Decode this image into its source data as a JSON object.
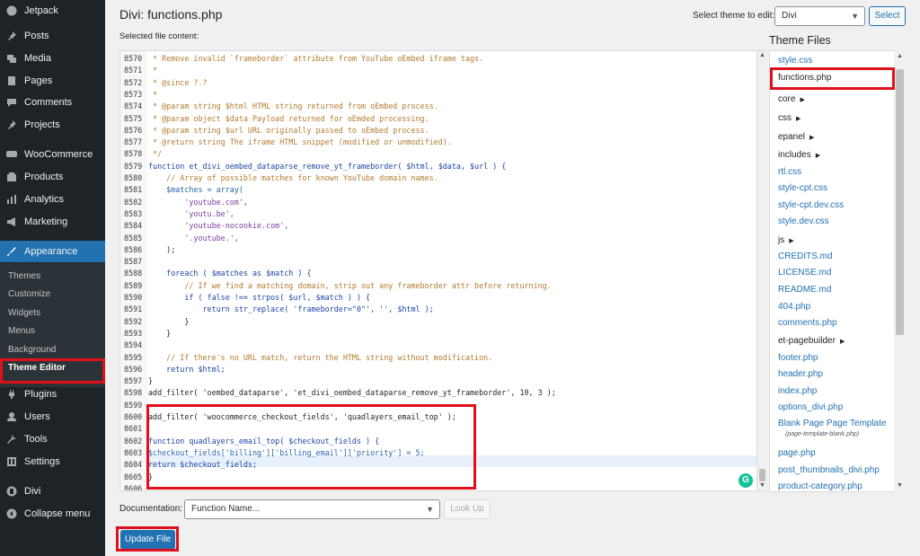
{
  "sidebar": {
    "menu": [
      {
        "label": "Jetpack",
        "icon": "jetpack-icon"
      },
      {
        "label": "Posts",
        "icon": "pin-icon"
      },
      {
        "label": "Media",
        "icon": "media-icon"
      },
      {
        "label": "Pages",
        "icon": "page-icon"
      },
      {
        "label": "Comments",
        "icon": "comment-icon"
      },
      {
        "label": "Projects",
        "icon": "pin-icon"
      },
      {
        "label": "WooCommerce",
        "icon": "woo-icon"
      },
      {
        "label": "Products",
        "icon": "product-icon"
      },
      {
        "label": "Analytics",
        "icon": "analytics-icon"
      },
      {
        "label": "Marketing",
        "icon": "megaphone-icon"
      },
      {
        "label": "Appearance",
        "icon": "brush-icon"
      },
      {
        "label": "Plugins",
        "icon": "plug-icon"
      },
      {
        "label": "Users",
        "icon": "user-icon"
      },
      {
        "label": "Tools",
        "icon": "wrench-icon"
      },
      {
        "label": "Settings",
        "icon": "settings-icon"
      },
      {
        "label": "Divi",
        "icon": "divi-icon"
      },
      {
        "label": "Collapse menu",
        "icon": "collapse-icon"
      }
    ],
    "submenu": [
      "Themes",
      "Customize",
      "Widgets",
      "Menus",
      "Background",
      "Theme Editor"
    ],
    "active_menu": "Appearance",
    "current_submenu": "Theme Editor",
    "accent_color": "#2271b1"
  },
  "header": {
    "title": "Divi: functions.php",
    "selected_file_label": "Selected file content:",
    "theme_select_label": "Select theme to edit:",
    "theme_select_value": "Divi",
    "select_button": "Select"
  },
  "editor": {
    "lines": [
      {
        "n": "8570",
        "t": " * Remove invalid `frameborder` attribute from YouTube oEmbed iframe tags."
      },
      {
        "n": "8571",
        "t": " *"
      },
      {
        "n": "8572",
        "t": " * @since ?.?"
      },
      {
        "n": "8573",
        "t": " *"
      },
      {
        "n": "8574",
        "t": " * @param string $html HTML string returned from oEmbed process."
      },
      {
        "n": "8575",
        "t": " * @param object $data Payload returned for oEmded processing."
      },
      {
        "n": "8576",
        "t": " * @param string $url URL originally passed to oEmbed process."
      },
      {
        "n": "8577",
        "t": " * @return string The iframe HTML snippet (modified or unmodified)."
      },
      {
        "n": "8578",
        "t": " */"
      },
      {
        "n": "8579",
        "t": "function et_divi_oembed_dataparse_remove_yt_frameborder( $html, $data, $url ) {"
      },
      {
        "n": "8580",
        "t": "    // Array of possible matches for known YouTube domain names."
      },
      {
        "n": "8581",
        "t": "    $matches = array("
      },
      {
        "n": "8582",
        "t": "        'youtube.com',"
      },
      {
        "n": "8583",
        "t": "        'youtu.be',"
      },
      {
        "n": "8584",
        "t": "        'youtube-nocookie.com',"
      },
      {
        "n": "8585",
        "t": "        '.youtube.',"
      },
      {
        "n": "8586",
        "t": "    );"
      },
      {
        "n": "8587",
        "t": ""
      },
      {
        "n": "8588",
        "t": "    foreach ( $matches as $match ) {"
      },
      {
        "n": "8589",
        "t": "        // If we find a matching domain, strip out any frameborder attr before returning."
      },
      {
        "n": "8590",
        "t": "        if ( false !== strpos( $url, $match ) ) {"
      },
      {
        "n": "8591",
        "t": "            return str_replace( 'frameborder=\"0\"', '', $html );"
      },
      {
        "n": "8592",
        "t": "        }"
      },
      {
        "n": "8593",
        "t": "    }"
      },
      {
        "n": "8594",
        "t": ""
      },
      {
        "n": "8595",
        "t": "    // If there's no URL match, return the HTML string without modification."
      },
      {
        "n": "8596",
        "t": "    return $html;"
      },
      {
        "n": "8597",
        "t": "}"
      },
      {
        "n": "8598",
        "t": "add_filter( 'oembed_dataparse', 'et_divi_oembed_dataparse_remove_yt_frameborder', 10, 3 );"
      },
      {
        "n": "8599",
        "t": ""
      },
      {
        "n": "8600",
        "t": "add_filter( 'woocommerce_checkout_fields', 'quadlayers_email_top' );"
      },
      {
        "n": "8601",
        "t": ""
      },
      {
        "n": "8602",
        "t": "function quadlayers_email_top( $checkout_fields ) {"
      },
      {
        "n": "8603",
        "t": "$checkout_fields['billing']['billing_email']['priority'] = 5;"
      },
      {
        "n": "8604",
        "t": "return $checkout_fields;"
      },
      {
        "n": "8605",
        "t": "}"
      },
      {
        "n": "8606",
        "t": ""
      }
    ],
    "highlight_color": "#e0101b",
    "grammarly_label": "G"
  },
  "theme_files": {
    "title": "Theme Files",
    "items": [
      {
        "label": "style.css",
        "dir": false
      },
      {
        "label": "functions.php",
        "dir": false,
        "current": true
      },
      {
        "label": "core",
        "dir": true
      },
      {
        "label": "css",
        "dir": true
      },
      {
        "label": "epanel",
        "dir": true
      },
      {
        "label": "includes",
        "dir": true
      },
      {
        "label": "rtl.css",
        "dir": false
      },
      {
        "label": "style-cpt.css",
        "dir": false
      },
      {
        "label": "style-cpt.dev.css",
        "dir": false
      },
      {
        "label": "style.dev.css",
        "dir": false
      },
      {
        "label": "js",
        "dir": true
      },
      {
        "label": "CREDITS.md",
        "dir": false
      },
      {
        "label": "LICENSE.md",
        "dir": false
      },
      {
        "label": "README.md",
        "dir": false
      },
      {
        "label": "404.php",
        "dir": false
      },
      {
        "label": "comments.php",
        "dir": false
      },
      {
        "label": "et-pagebuilder",
        "dir": true
      },
      {
        "label": "footer.php",
        "dir": false
      },
      {
        "label": "header.php",
        "dir": false
      },
      {
        "label": "index.php",
        "dir": false
      },
      {
        "label": "options_divi.php",
        "dir": false
      },
      {
        "label": "Blank Page Page Template",
        "dir": false,
        "sub": "(page-template-blank.php)"
      },
      {
        "label": "page.php",
        "dir": false
      },
      {
        "label": "post_thumbnails_divi.php",
        "dir": false
      },
      {
        "label": "product-category.php",
        "dir": false
      }
    ]
  },
  "footer": {
    "documentation_label": "Documentation:",
    "function_select_placeholder": "Function Name...",
    "lookup_button": "Look Up",
    "update_button": "Update File"
  }
}
